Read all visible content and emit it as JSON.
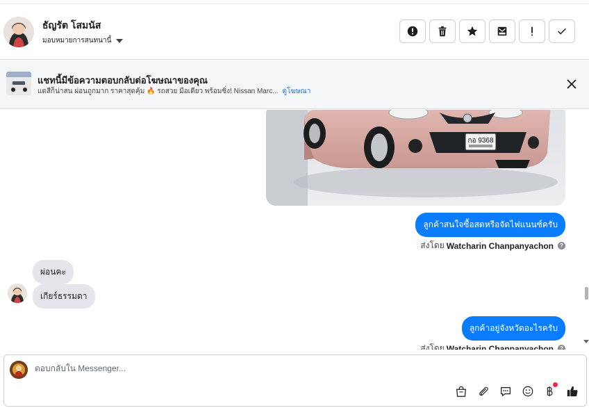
{
  "header": {
    "contact_name": "ธัญรัต โสมนัส",
    "assign_label": "มอบหมายการสนทนานี้",
    "actions": [
      {
        "name": "report-spam-button",
        "icon": "alert-circle-icon"
      },
      {
        "name": "delete-button",
        "icon": "trash-icon"
      },
      {
        "name": "star-button",
        "icon": "star-icon"
      },
      {
        "name": "move-to-folder-button",
        "icon": "archive-tray-icon"
      },
      {
        "name": "mark-important-button",
        "icon": "exclamation-icon"
      },
      {
        "name": "mark-done-button",
        "icon": "check-icon"
      }
    ]
  },
  "ad_banner": {
    "title": "แชทนี้มีข้อความตอบกลับต่อโฆษณาของคุณ",
    "subtitle": "แดสีก็น่าสน ผ่อนถูกมาก ราคาสุดคุ้ม 🔥 รถสวย มือเดียว พร้อมซิ่ง! Nissan Marc...",
    "link_label": "ดูโฆษณา"
  },
  "messages": {
    "out_1": "ลูกค้าสนใจซื้อสดหรือจัดไฟแนนซ์ครับ",
    "sent_by_prefix": "ส่งโดย",
    "sent_by_name": "Watcharin Chanpanyachon",
    "in_1": "ผ่อนคะ",
    "in_2": "เกียร์ธรรมดา",
    "out_2": "ลูกค้าอยู่จังหวัดอะไรครับ",
    "plate_text": "กอ 9368"
  },
  "composer": {
    "placeholder": "ตอบกลับใน Messenger..."
  },
  "colors": {
    "accent": "#0a7cff",
    "incoming_bubble": "#e4e6eb",
    "car_body": "#d8a9a3"
  }
}
